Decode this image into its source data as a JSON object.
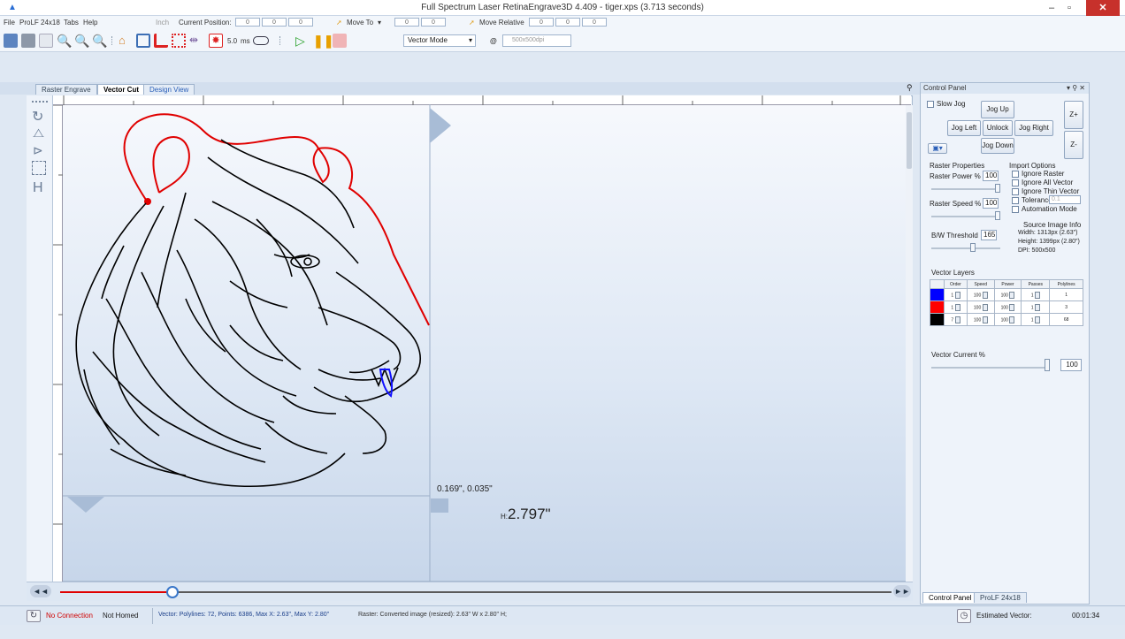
{
  "window": {
    "title": "Full Spectrum Laser RetinaEngrave3D 4.409 - tiger.xps (3.713 seconds)"
  },
  "menu": {
    "items": [
      "File",
      "ProLF 24x18",
      "Tabs",
      "Help"
    ],
    "units": "Inch",
    "current_position_label": "Current Position:",
    "current_position": [
      "0",
      "0",
      "0"
    ],
    "move_to_label": "Move To",
    "move_to": [
      "0",
      "0"
    ],
    "move_relative_label": "Move Relative",
    "move_relative": [
      "0",
      "0",
      "0"
    ]
  },
  "toolbar": {
    "time_value": "5.0",
    "time_unit": "ms",
    "mode": "Vector Mode",
    "at": "@",
    "resolution": "500x500dpi"
  },
  "tabs": [
    "Raster Engrave",
    "Vector Cut",
    "Design View"
  ],
  "canvas": {
    "coords": "0.169\", 0.035\"",
    "height_label": "H:",
    "height_value": "2.797\""
  },
  "panel": {
    "title": "Control Panel",
    "slow_jog": "Slow Jog",
    "jog_up": "Jog Up",
    "jog_left": "Jog Left",
    "unlock": "Unlock",
    "jog_right": "Jog Right",
    "jog_down": "Jog Down",
    "z_plus": "Z+",
    "z_minus": "Z-",
    "raster_properties": "Raster Properties",
    "raster_power_label": "Raster Power %",
    "raster_power": "100",
    "raster_speed_label": "Raster Speed %",
    "raster_speed": "100",
    "bw_threshold_label": "B/W Threshold",
    "bw_threshold": "165",
    "import_options": "Import Options",
    "ignore_raster": "Ignore Raster",
    "ignore_all_vector": "Ignore All Vector",
    "ignore_thin_vector": "Ignore Thin Vector",
    "tolerance_label": "Tolerance",
    "tolerance": "0.1",
    "automation_mode": "Automation Mode",
    "source_info": "Source Image Info",
    "width": "Width: 1313px (2.63\")",
    "height": "Height: 1399px (2.80\")",
    "dpi": "DPI: 500x500",
    "vector_layers": "Vector Layers",
    "layer_headers": [
      "Order",
      "Speed",
      "Power",
      "Passes",
      "Polylines"
    ],
    "layers": [
      {
        "color": "#0000ff",
        "order": "1",
        "speed": "100",
        "power": "100",
        "passes": "1",
        "polylines": "1"
      },
      {
        "color": "#ff0000",
        "order": "1",
        "speed": "100",
        "power": "100",
        "passes": "1",
        "polylines": "3"
      },
      {
        "color": "#000000",
        "order": "7",
        "speed": "100",
        "power": "100",
        "passes": "1",
        "polylines": "68"
      }
    ],
    "vector_current_label": "Vector Current %",
    "vector_current": "100",
    "bottom_tabs": [
      "Control Panel",
      "ProLF 24x18"
    ]
  },
  "status": {
    "no_connection": "No Connection",
    "not_homed": "Not Homed",
    "vector_info": "Vector: Polylines: 72, Points: 6386, Max X: 2.63\", Max Y: 2.80\"",
    "raster_info": "Raster: Converted image (resized): 2.63\" W x 2.80\" H;",
    "estimated_label": "Estimated Vector:",
    "estimated_time": "00:01:34"
  },
  "colors": {
    "accent": "#2a6ed5",
    "red_stroke": "#e00000",
    "blue_stroke": "#1010ff",
    "error_text": "#d00000"
  },
  "icons": [
    "app-logo-icon",
    "open-icon",
    "print-icon",
    "zoom-in-icon",
    "zoom-out-icon",
    "home-icon",
    "play-icon",
    "pause-icon",
    "stop-icon",
    "save-icon",
    "timer-icon",
    "connection-icon"
  ]
}
